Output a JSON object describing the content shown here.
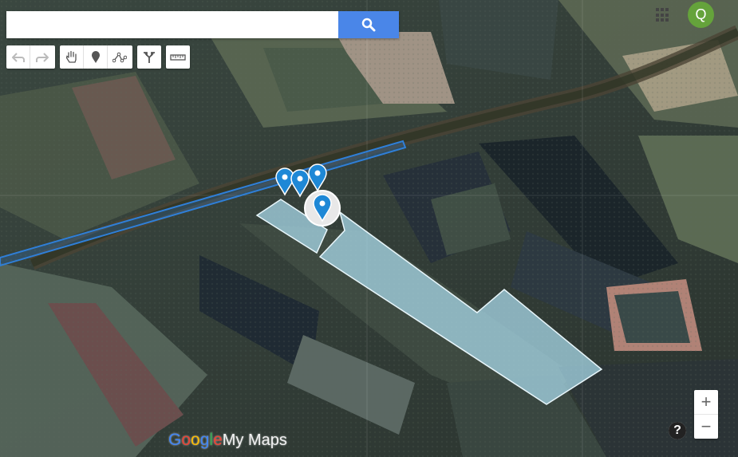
{
  "search": {
    "placeholder": "",
    "value": ""
  },
  "toolbar": {
    "history": [
      "undo-icon",
      "redo-icon"
    ],
    "tools": [
      "hand-icon",
      "marker-icon",
      "draw-line-icon"
    ],
    "directions": "directions-icon",
    "measure": "ruler-icon"
  },
  "account": {
    "initial": "Q",
    "color": "#65a33b"
  },
  "zoom": {
    "in": "+",
    "out": "−"
  },
  "help": {
    "symbol": "?"
  },
  "logo": {
    "letters": [
      "G",
      "o",
      "o",
      "g",
      "l",
      "e"
    ],
    "product": "My Maps"
  },
  "colors": {
    "search_button": "#4a86e8",
    "line": "#2f7fd8",
    "polygon_fill": "#a8d8e8",
    "pin": "#1e88d6"
  }
}
